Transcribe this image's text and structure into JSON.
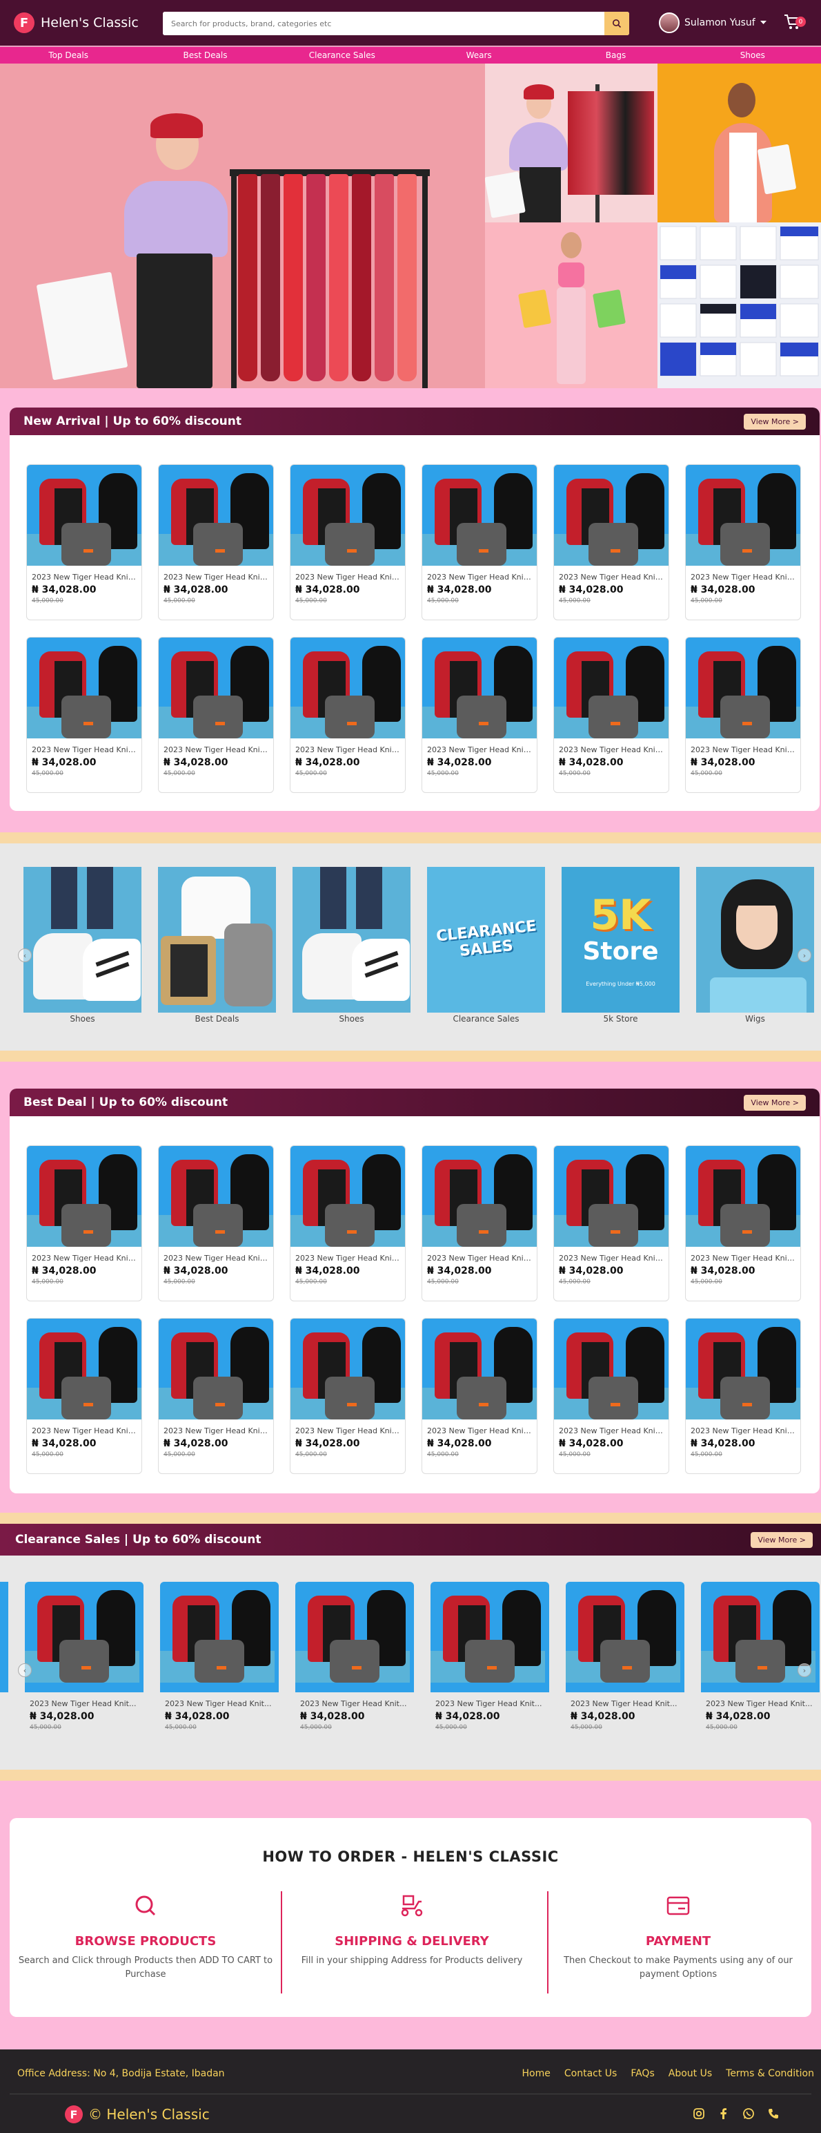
{
  "header": {
    "logo_letter": "F",
    "brand": "Helen's Classic",
    "search_placeholder": "Search for products, brand, categories etc",
    "user_name": "Sulamon Yusuf",
    "cart_count": "0"
  },
  "nav": [
    "Top Deals",
    "Best Deals",
    "Clearance Sales",
    "Wears",
    "Bags",
    "Shoes"
  ],
  "product": {
    "name": "2023 New Tiger Head Knit...",
    "price": "₦ 34,028.00",
    "old_price": "45,000.00"
  },
  "new_arrival": {
    "title": "New Arrival | Up to 60% discount",
    "view_more": "View More >"
  },
  "best_deal": {
    "title": "Best Deal | Up to 60% discount",
    "view_more": "View More >"
  },
  "clearance": {
    "title": "Clearance Sales | Up to 60% discount",
    "view_more": "View More >"
  },
  "categories": [
    {
      "label": "Shoes"
    },
    {
      "label": "Best Deals"
    },
    {
      "label": "Shoes"
    },
    {
      "label": "Clearance Sales",
      "art_line1": "CLEARANCE",
      "art_line2": "SALES"
    },
    {
      "label": "5k Store",
      "art_line1": "5K",
      "art_line2": "Store",
      "art_line3": "Everything Under ₦5,000"
    },
    {
      "label": "Wigs"
    }
  ],
  "howto": {
    "title": "HOW TO ORDER - HELEN'S CLASSIC",
    "steps": [
      {
        "title": "BROWSE PRODUCTS",
        "desc": "Search and Click through Products then ADD TO CART to Purchase"
      },
      {
        "title": "SHIPPING & DELIVERY",
        "desc": "Fill in your shipping Address for Products delivery"
      },
      {
        "title": "PAYMENT",
        "desc": "Then Checkout to make Payments using any of our payment Options"
      }
    ]
  },
  "footer": {
    "address": "Office Address: No 4, Bodija Estate, Ibadan",
    "links": [
      "Home",
      "Contact Us",
      "FAQs",
      "About Us",
      "Terms & Condition"
    ],
    "copyright": "© Helen's Classic"
  },
  "colors": {
    "header_bg": "#4a1030",
    "nav_bg": "#e8278e",
    "page_bg": "#fdb9da",
    "accent": "#dd245a",
    "footer_bg": "#262326",
    "footer_text": "#f7d25b"
  }
}
